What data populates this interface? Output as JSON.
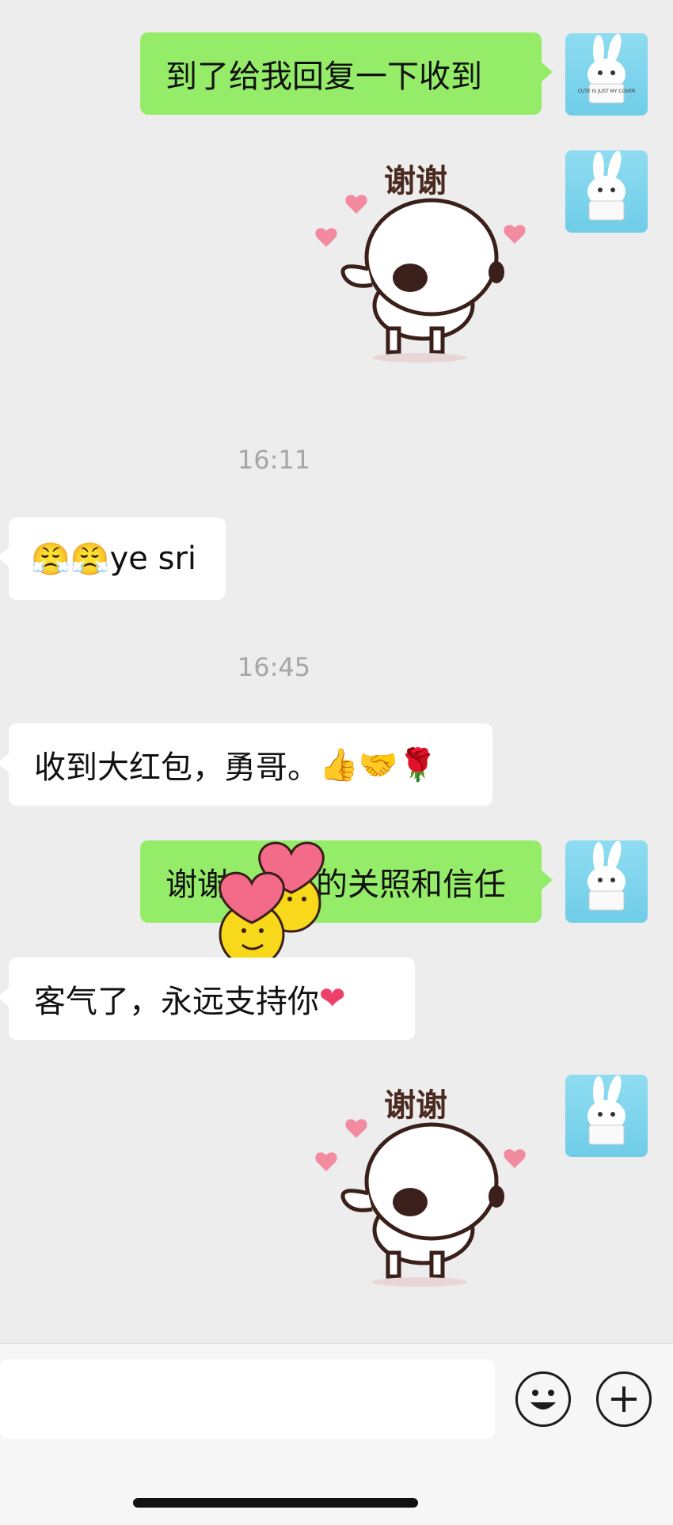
{
  "messages": [
    {
      "side": "out",
      "type": "text",
      "text": "到了给我回复一下收到"
    },
    {
      "side": "out",
      "type": "sticker",
      "caption": "谢谢"
    },
    {
      "type": "time",
      "text": "16:11"
    },
    {
      "side": "in",
      "type": "text",
      "emoji": "😤😤",
      "text": "ye sri"
    },
    {
      "type": "time",
      "text": "16:45"
    },
    {
      "side": "in",
      "type": "text",
      "text": "收到大红包，勇哥。",
      "emoji": "👍🤝🌹"
    },
    {
      "side": "out",
      "type": "text",
      "text_before": "谢谢",
      "text_after": "的关照和信任"
    },
    {
      "side": "in",
      "type": "text",
      "text": "客气了，永远支持你",
      "emoji": "❤"
    },
    {
      "side": "out",
      "type": "sticker",
      "caption": "谢谢"
    }
  ],
  "avatar": {
    "icon": "snowball-bunny-avatar",
    "sign_text": "CUTE IS JUST MY COVER"
  },
  "input_bar": {
    "placeholder": "",
    "emoji_button_icon": "smiley-icon",
    "more_button_icon": "plus-circle-icon"
  },
  "colors": {
    "outgoing": "#95ec69",
    "incoming": "#ffffff",
    "background": "#ededed"
  }
}
